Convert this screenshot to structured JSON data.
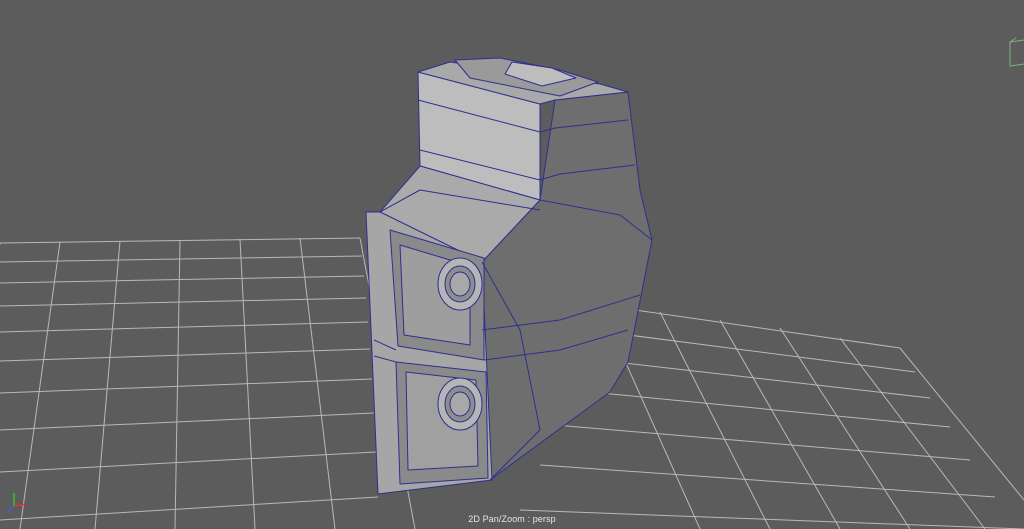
{
  "viewport": {
    "camera_name": "persp",
    "hud_label": "2D Pan/Zoom : persp"
  },
  "colors": {
    "background": "#5c5c5c",
    "grid_line": "#c9c9c9",
    "mesh_fill_light": "#b8b8b8",
    "mesh_fill_mid": "#8e8e8e",
    "mesh_fill_dark": "#6b6b6b",
    "wireframe": "#2f2f8f",
    "axis_x": "#e03434",
    "axis_y": "#34c234",
    "axis_z": "#3a5fe0"
  },
  "icons": {
    "view_cube": "view-cube-icon",
    "axis_gizmo": "axis-gizmo-icon"
  }
}
